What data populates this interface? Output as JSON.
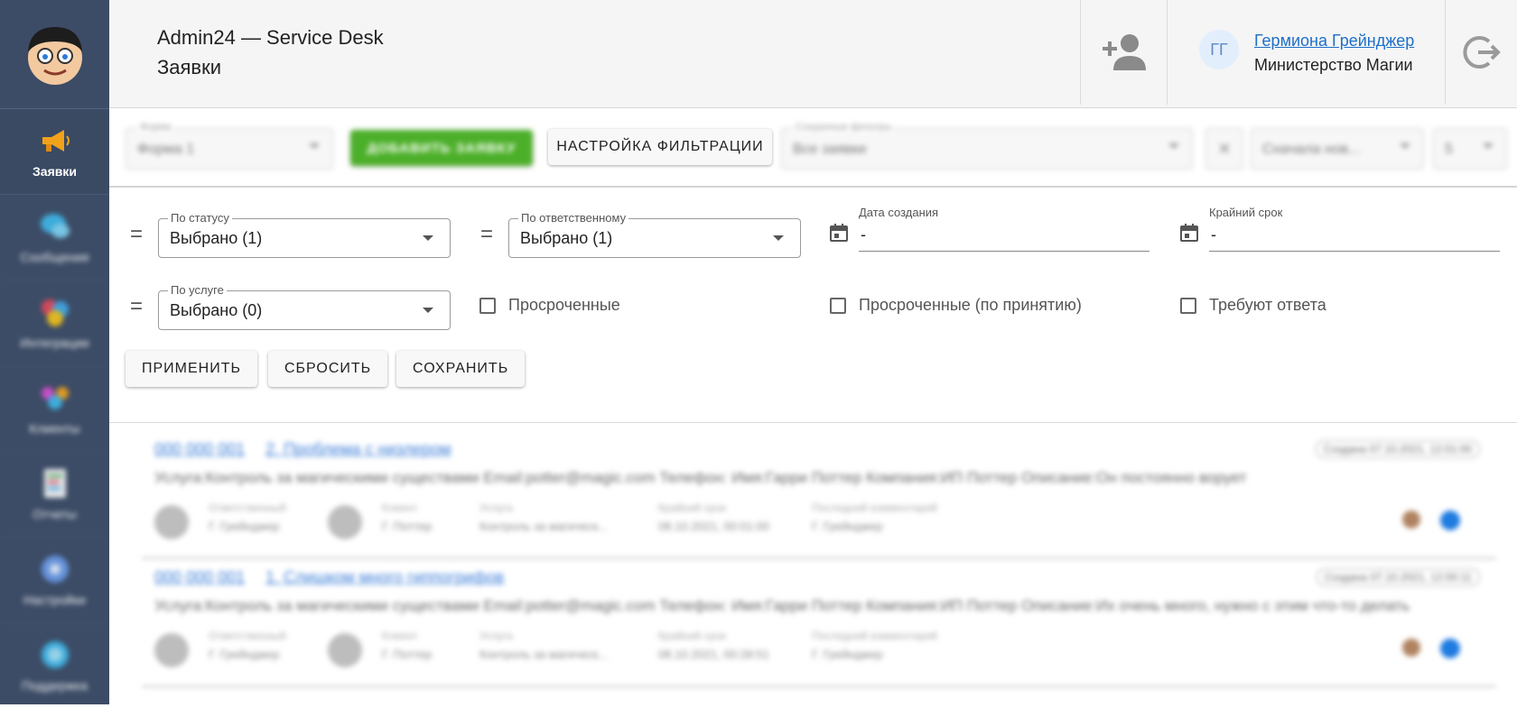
{
  "sidebar": {
    "logo_icon": "cartoon-avatar-logo",
    "items": [
      {
        "label": "Заявки",
        "icon": "megaphone-icon"
      },
      {
        "label": "Сообщения",
        "icon": "chat-icon"
      },
      {
        "label": "Интеграции",
        "icon": "integrations-icon"
      },
      {
        "label": "Клиенты",
        "icon": "clients-icon"
      },
      {
        "label": "Отчеты",
        "icon": "reports-icon"
      },
      {
        "label": "Настройки",
        "icon": "settings-icon"
      },
      {
        "label": "Поддержка",
        "icon": "support-icon"
      }
    ]
  },
  "header": {
    "title": "Admin24 — Service Desk",
    "subtitle": "Заявки",
    "user_initials": "ГГ",
    "user_name": "Гермиона Грейнджер",
    "user_org": "Министерство Магии"
  },
  "toolbar": {
    "form_label": "Форма",
    "form_value": "Форма 1",
    "add_ticket": "ДОБАВИТЬ ЗАЯВКУ",
    "filter_settings": "НАСТРОЙКА ФИЛЬТРАЦИИ",
    "saved_filters_label": "Сохранные фильтры",
    "saved_filters_value": "Все заявки",
    "clear": "✕",
    "sort_value": "Сначала нов...",
    "per_page_value": "5"
  },
  "filters": {
    "status": {
      "label": "По статусу",
      "value": "Выбрано (1)"
    },
    "responsible": {
      "label": "По ответственному",
      "value": "Выбрано (1)"
    },
    "created": {
      "label": "Дата создания",
      "value": "-"
    },
    "deadline": {
      "label": "Крайний срок",
      "value": "-"
    },
    "service": {
      "label": "По услуге",
      "value": "Выбрано (0)"
    },
    "overdue": "Просроченные",
    "overdue_accept": "Просроченные (по принятию)",
    "need_reply": "Требуют ответа",
    "apply": "ПРИМЕНИТЬ",
    "reset": "СБРОСИТЬ",
    "save": "СОХРАНИТЬ"
  },
  "tickets": [
    {
      "number": "000 000 001",
      "title": "2. Проблема с низлером",
      "date": "Создана 07.10.2021, 12:01:00",
      "desc": "Услуга:Контроль за магическими существами Email:potter@magic.com Телефон: Имя:Гарри Поттер Компания:ИП Поттер Описание:Он постоянно ворует",
      "resp_label": "Ответственный",
      "resp": "Г. Грейнджер",
      "client_label": "Клиент",
      "client": "Г. Поттер",
      "service_label": "Услуга",
      "service": "Контроль за магическ...",
      "deadline_label": "Крайний срок",
      "deadline": "08.10.2021, 00:01:00",
      "comment_label": "Последний комментарий",
      "comment": "Г. Грейнджер"
    },
    {
      "number": "000 000 001",
      "title": "1. Слишком много гиппогрифов",
      "date": "Создана 07.10.2021, 12:00:11",
      "desc": "Услуга:Контроль за магическими существами Email:potter@magic.com Телефон: Имя:Гарри Поттер Компания:ИП Поттер Описание:Их очень много, нужно с этим что-то делать",
      "resp_label": "Ответственный",
      "resp": "Г. Грейнджер",
      "client_label": "Клиент",
      "client": "Г. Поттер",
      "service_label": "Услуга",
      "service": "Контроль за магическ...",
      "deadline_label": "Крайний срок",
      "deadline": "08.10.2021, 00:28:51",
      "comment_label": "Последний комментарий",
      "comment": "Г. Грейнджер"
    }
  ]
}
